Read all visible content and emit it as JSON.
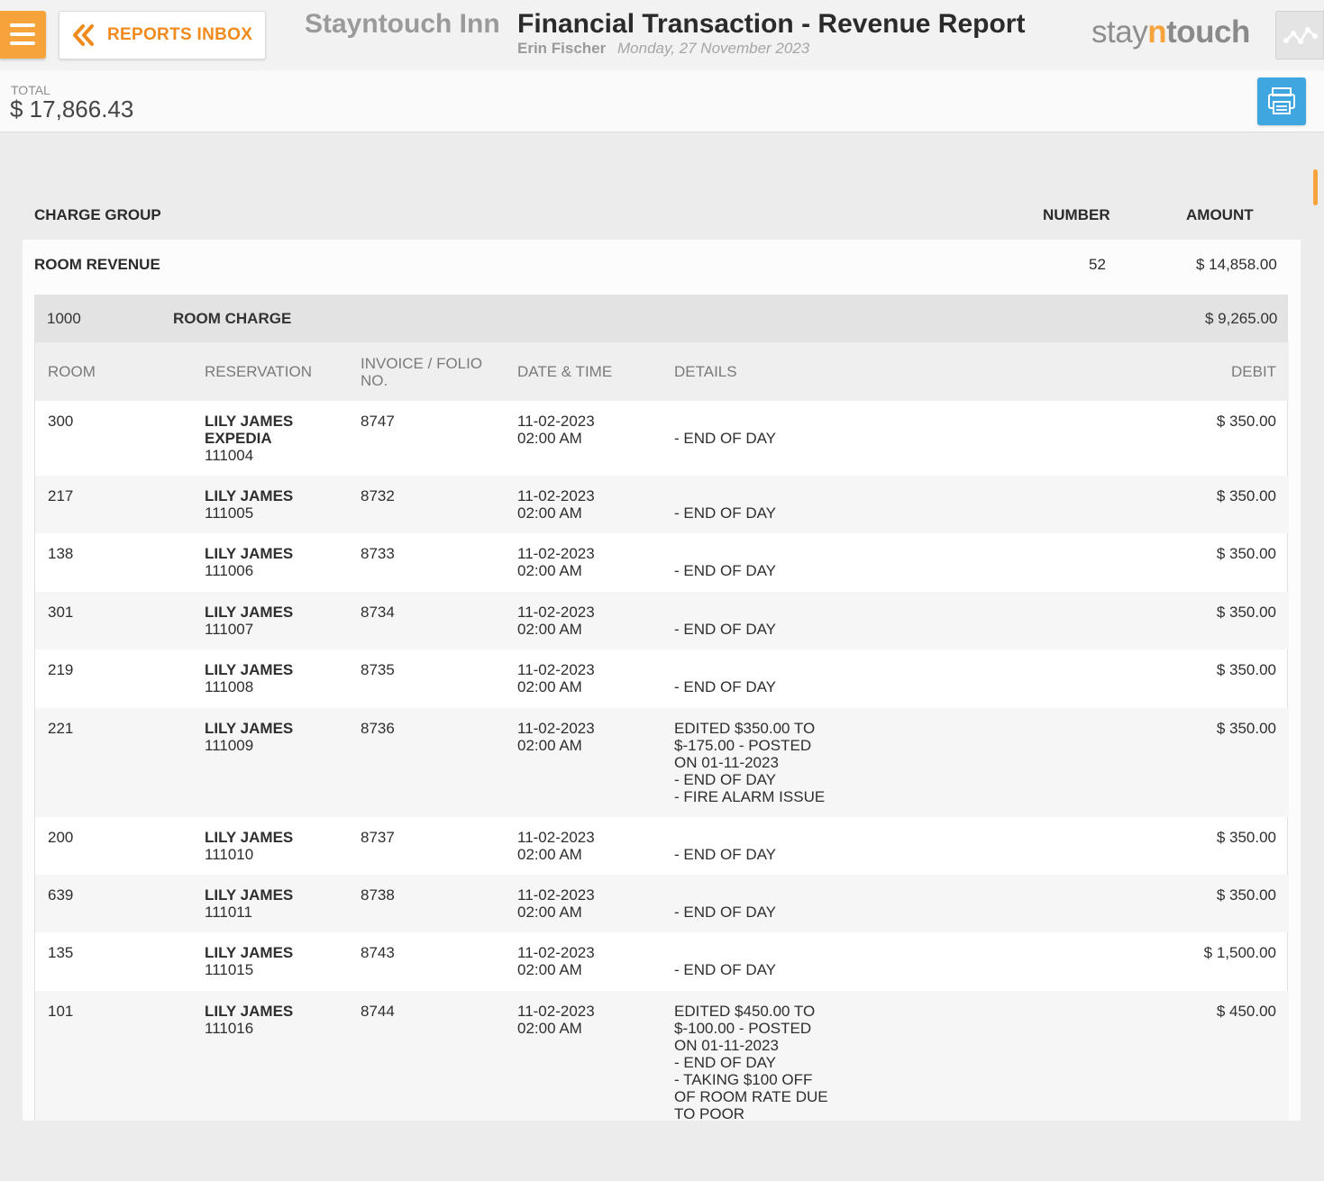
{
  "header": {
    "back_label": "REPORTS INBOX",
    "hotel_name": "Stayntouch Inn",
    "report_title": "Financial Transaction - Revenue Report",
    "user_name": "Erin Fischer",
    "report_date": "Monday, 27 November 2023",
    "logo": {
      "part1": "stay",
      "part2": "n",
      "part3": "touch"
    }
  },
  "summary": {
    "total_label": "TOTAL",
    "total_value": "$ 17,866.43"
  },
  "columns": {
    "charge_group": "CHARGE GROUP",
    "number": "NUMBER",
    "amount": "AMOUNT"
  },
  "group": {
    "name": "ROOM REVENUE",
    "number": "52",
    "amount": "$ 14,858.00",
    "charge_code": "1000",
    "charge_name": "ROOM CHARGE",
    "charge_amount": "$ 9,265.00"
  },
  "table": {
    "headers": {
      "room": "ROOM",
      "reservation": "RESERVATION",
      "invoice": "INVOICE / FOLIO NO.",
      "datetime": "DATE & TIME",
      "details": "DETAILS",
      "debit": "DEBIT"
    },
    "rows": [
      {
        "room": "300",
        "guest": "LILY JAMES\nEXPEDIA",
        "res_no": "111004",
        "invoice": "8747",
        "datetime": "11-02-2023\n02:00 AM",
        "details": "\n- END OF DAY",
        "debit": "$ 350.00"
      },
      {
        "room": "217",
        "guest": "LILY JAMES",
        "res_no": "111005",
        "invoice": "8732",
        "datetime": "11-02-2023\n02:00 AM",
        "details": "\n- END OF DAY",
        "debit": "$ 350.00"
      },
      {
        "room": "138",
        "guest": "LILY JAMES",
        "res_no": "111006",
        "invoice": "8733",
        "datetime": "11-02-2023\n02:00 AM",
        "details": "\n- END OF DAY",
        "debit": "$ 350.00"
      },
      {
        "room": "301",
        "guest": "LILY JAMES",
        "res_no": "111007",
        "invoice": "8734",
        "datetime": "11-02-2023\n02:00 AM",
        "details": "\n- END OF DAY",
        "debit": "$ 350.00"
      },
      {
        "room": "219",
        "guest": "LILY JAMES",
        "res_no": "111008",
        "invoice": "8735",
        "datetime": "11-02-2023\n02:00 AM",
        "details": "\n- END OF DAY",
        "debit": "$ 350.00"
      },
      {
        "room": "221",
        "guest": "LILY JAMES",
        "res_no": "111009",
        "invoice": "8736",
        "datetime": "11-02-2023\n02:00 AM",
        "details": "EDITED $350.00 TO\n$-175.00 - POSTED\nON 01-11-2023\n- END OF DAY\n- FIRE ALARM ISSUE",
        "debit": "$ 350.00"
      },
      {
        "room": "200",
        "guest": "LILY JAMES",
        "res_no": "111010",
        "invoice": "8737",
        "datetime": "11-02-2023\n02:00 AM",
        "details": "\n- END OF DAY",
        "debit": "$ 350.00"
      },
      {
        "room": "639",
        "guest": "LILY JAMES",
        "res_no": "111011",
        "invoice": "8738",
        "datetime": "11-02-2023\n02:00 AM",
        "details": "\n- END OF DAY",
        "debit": "$ 350.00"
      },
      {
        "room": "135",
        "guest": "LILY JAMES",
        "res_no": "111015",
        "invoice": "8743",
        "datetime": "11-02-2023\n02:00 AM",
        "details": "\n- END OF DAY",
        "debit": "$ 1,500.00"
      },
      {
        "room": "101",
        "guest": "LILY JAMES",
        "res_no": "111016",
        "invoice": "8744",
        "datetime": "11-02-2023\n02:00 AM",
        "details": "EDITED $450.00 TO\n$-100.00 - POSTED\nON 01-11-2023\n- END OF DAY\n- TAKING $100 OFF\nOF ROOM RATE DUE\nTO POOR",
        "debit": "$ 450.00"
      }
    ]
  }
}
